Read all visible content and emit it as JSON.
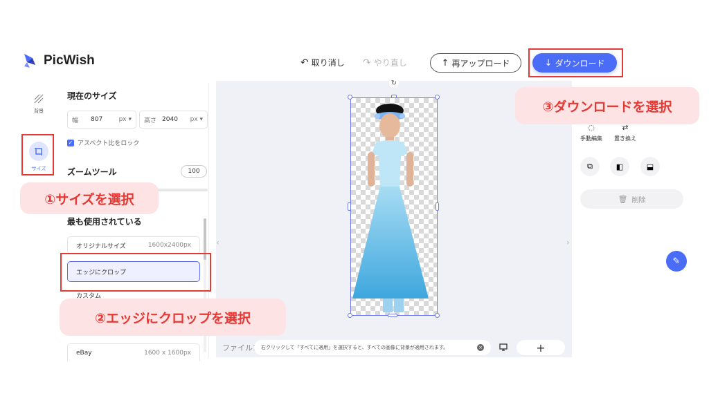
{
  "header": {
    "brand": "PicWish",
    "undo": "取り消し",
    "redo": "やり直し",
    "reupload": "再アップロード",
    "download": "ダウンロード"
  },
  "rail": {
    "background_label": "背景",
    "size_label": "サイズ"
  },
  "panel": {
    "current_size_title": "現在のサイズ",
    "width_label": "幅",
    "width_value": "807",
    "width_unit": "px ▾",
    "height_label": "高さ",
    "height_value": "2040",
    "height_unit": "px ▾",
    "lock_aspect": "アスペクト比をロック",
    "zoom_title": "ズームツール",
    "zoom_value": "100",
    "most_used_title": "最も使用されている",
    "presets": [
      {
        "label": "オリジナルサイズ",
        "size": "1600x2400px"
      },
      {
        "label": "エッジにクロップ",
        "size": ""
      },
      {
        "label": "カスタム",
        "size": ""
      },
      {
        "label": "eBay",
        "size": "1600 x 1600px"
      }
    ]
  },
  "canvas": {
    "file_label": "ファイル1",
    "hint": "右クリックして「すべてに適用」を選択すると、すべての画像に背景が適用されます。"
  },
  "right": {
    "manual_edit": "手動編集",
    "replace": "置き換え",
    "delete": "削除"
  },
  "annotations": {
    "step1": "①サイズを選択",
    "step2": "②エッジにクロップを選択",
    "step3": "③ダウンロードを選択"
  },
  "colors": {
    "accent": "#4a6cf7",
    "annotation_red": "#e53935",
    "annotation_bg": "#fde3e3"
  }
}
